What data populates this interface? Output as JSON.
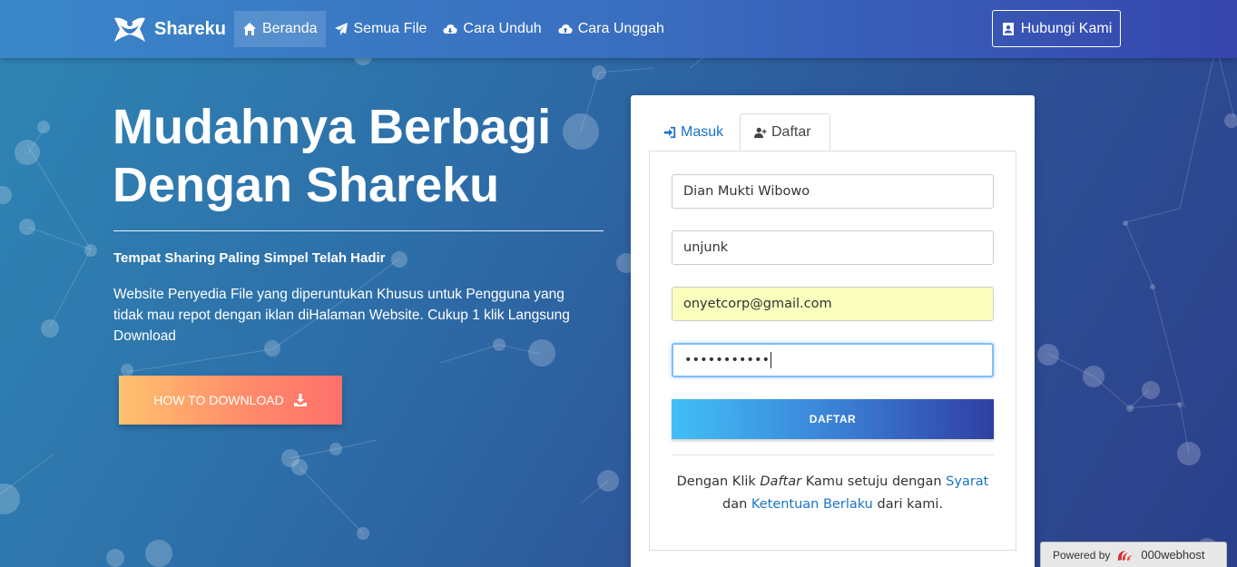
{
  "brand": {
    "name": "Shareku"
  },
  "nav": {
    "items": [
      {
        "label": "Beranda",
        "icon": "home-icon",
        "active": true
      },
      {
        "label": "Semua File",
        "icon": "paper-plane-icon",
        "active": false
      },
      {
        "label": "Cara Unduh",
        "icon": "cloud-download-icon",
        "active": false
      },
      {
        "label": "Cara Unggah",
        "icon": "cloud-upload-icon",
        "active": false
      }
    ],
    "contact_label": "Hubungi Kami"
  },
  "hero": {
    "title_line1": "Mudahnya Berbagi",
    "title_line2": "Dengan Shareku",
    "subtitle": "Tempat Sharing Paling Simpel Telah Hadir",
    "description": "Website Penyedia File yang diperuntukan Khusus untuk Pengguna yang tidak mau repot dengan iklan diHalaman Website. Cukup 1 klik Langsung Download",
    "button_label": "HOW TO DOWNLOAD"
  },
  "form": {
    "tabs": [
      {
        "label": "Masuk",
        "icon": "sign-in-icon",
        "active": false
      },
      {
        "label": "Daftar",
        "icon": "user-plus-icon",
        "active": true
      }
    ],
    "fields": {
      "fullname": "Dian Mukti Wibowo",
      "username": "unjunk",
      "email": "onyetcorp@gmail.com",
      "password": "•••••••••••"
    },
    "submit_label": "DAFTAR",
    "terms": {
      "prefix": "Dengan Klik ",
      "emphasis": "Daftar",
      "middle": " Kamu setuju dengan ",
      "link1": "Syarat",
      "and": "dan ",
      "link2": "Ketentuan Berlaku",
      "suffix": " dari kami."
    }
  },
  "powered": {
    "label": "Powered by",
    "host": "000webhost"
  },
  "colors": {
    "accent_link": "#1a73c8",
    "autofill": "#faffbd",
    "cta_start": "#ffc26f",
    "cta_end": "#ff6f6b",
    "submit_start": "#41bff7",
    "submit_end": "#2f3fa3"
  }
}
